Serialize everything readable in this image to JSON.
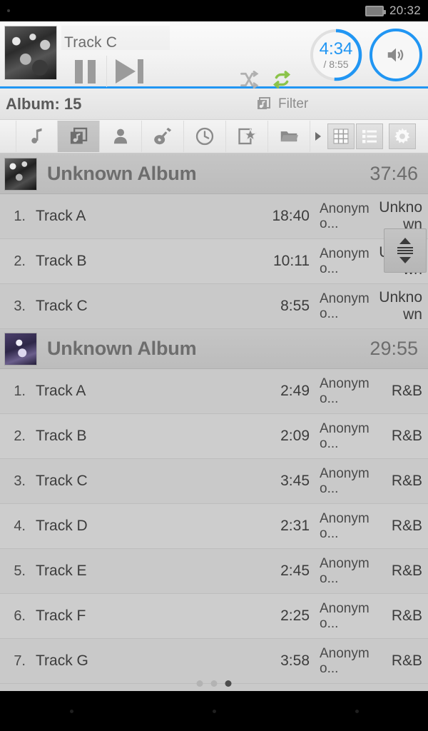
{
  "status_bar": {
    "time": "20:32",
    "battery_icon": "battery-icon"
  },
  "player": {
    "now_playing_title": "Track C",
    "album_art": "now-playing-album-art",
    "pause_label": "pause-button",
    "next_label": "next-track-button",
    "shuffle_label": "shuffle-toggle",
    "shuffle_state": "off",
    "repeat_label": "repeat-toggle",
    "repeat_state": "on",
    "repeat_color": "#8bc34a",
    "accent_color": "#2196f3",
    "elapsed": "4:34",
    "total": "/ 8:55",
    "progress_percent": 51,
    "volume_label": "volume-button"
  },
  "subheader": {
    "album_count_label": "Album: 15",
    "filter_label": "Filter",
    "filter_icon": "album-note-icon"
  },
  "toolbar": {
    "tabs": [
      {
        "name": "tab-songs",
        "icon": "music-note-icon",
        "active": false
      },
      {
        "name": "tab-albums",
        "icon": "album-note-icon",
        "active": true
      },
      {
        "name": "tab-artists",
        "icon": "person-icon",
        "active": false
      },
      {
        "name": "tab-genres",
        "icon": "guitar-icon",
        "active": false
      },
      {
        "name": "tab-recent",
        "icon": "clock-icon",
        "active": false
      },
      {
        "name": "tab-playlists",
        "icon": "playlist-star-icon",
        "active": false
      },
      {
        "name": "tab-folders",
        "icon": "folder-icon",
        "active": false
      }
    ],
    "overflow_icon": "chevron-right-icon",
    "grid_view_icon": "grid-view-icon",
    "list_view_icon": "list-view-icon",
    "settings_icon": "gear-icon"
  },
  "albums": [
    {
      "title": "Unknown Album",
      "duration": "37:46",
      "art": "album-art-1",
      "tracks": [
        {
          "num": "1.",
          "title": "Track A",
          "duration": "18:40",
          "artist": "Anonymo...",
          "genre": "Unknown"
        },
        {
          "num": "2.",
          "title": "Track B",
          "duration": "10:11",
          "artist": "Anonymo...",
          "genre": "Unknown"
        },
        {
          "num": "3.",
          "title": "Track C",
          "duration": "8:55",
          "artist": "Anonymo...",
          "genre": "Unknown"
        }
      ]
    },
    {
      "title": "Unknown Album",
      "duration": "29:55",
      "art": "album-art-2",
      "tracks": [
        {
          "num": "1.",
          "title": "Track A",
          "duration": "2:49",
          "artist": "Anonymo...",
          "genre": "R&B"
        },
        {
          "num": "2.",
          "title": "Track B",
          "duration": "2:09",
          "artist": "Anonymo...",
          "genre": "R&B"
        },
        {
          "num": "3.",
          "title": "Track C",
          "duration": "3:45",
          "artist": "Anonymo...",
          "genre": "R&B"
        },
        {
          "num": "4.",
          "title": "Track D",
          "duration": "2:31",
          "artist": "Anonymo...",
          "genre": "R&B"
        },
        {
          "num": "5.",
          "title": "Track E",
          "duration": "2:45",
          "artist": "Anonymo...",
          "genre": "R&B"
        },
        {
          "num": "6.",
          "title": "Track F",
          "duration": "2:25",
          "artist": "Anonymo...",
          "genre": "R&B"
        },
        {
          "num": "7.",
          "title": "Track G",
          "duration": "3:58",
          "artist": "Anonymo...",
          "genre": "R&B"
        }
      ]
    }
  ],
  "scrollbar": {
    "name": "scroll-thumb",
    "up_icon": "caret-up-icon",
    "down_icon": "caret-down-icon"
  },
  "page_dots": {
    "total": 3,
    "active_index": 2
  },
  "nav_bar": {
    "back": "back-key",
    "home": "home-key",
    "recents": "recents-key"
  }
}
